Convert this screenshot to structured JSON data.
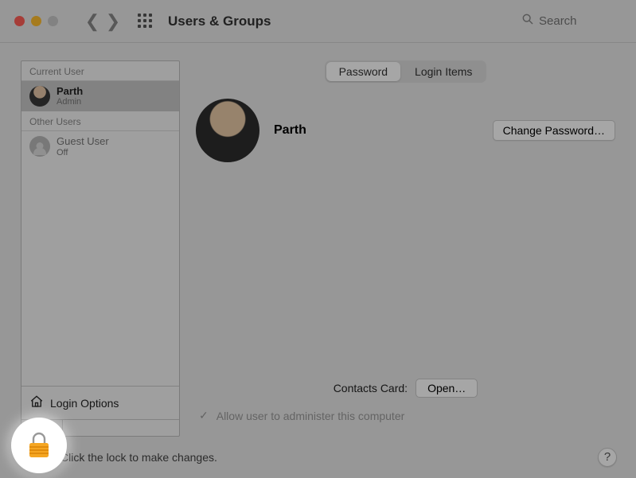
{
  "header": {
    "title": "Users & Groups",
    "search_placeholder": "Search"
  },
  "sidebar": {
    "sections": [
      {
        "label": "Current User",
        "users": [
          {
            "name": "Parth",
            "role": "Admin"
          }
        ]
      },
      {
        "label": "Other Users",
        "users": [
          {
            "name": "Guest User",
            "role": "Off"
          }
        ]
      }
    ],
    "login_options_label": "Login Options",
    "plus": "+",
    "minus": "−"
  },
  "tabs": {
    "password": "Password",
    "login_items": "Login Items",
    "active": "password"
  },
  "detail": {
    "user_name": "Parth",
    "change_password_label": "Change Password…",
    "contacts_label": "Contacts Card:",
    "open_label": "Open…",
    "admin_checkbox_label": "Allow user to administer this computer",
    "admin_checked": true
  },
  "footer": {
    "lock_text": "Click the lock to make changes.",
    "help": "?"
  },
  "icons": {
    "search": "search-icon",
    "grid": "grid-icon",
    "home": "home-icon",
    "lock": "lock-icon",
    "chevron_left": "chevron-left-icon",
    "chevron_right": "chevron-right-icon",
    "check": "check-icon"
  },
  "colors": {
    "lock_body": "#f5a623",
    "lock_stripe": "#e08c0e"
  }
}
